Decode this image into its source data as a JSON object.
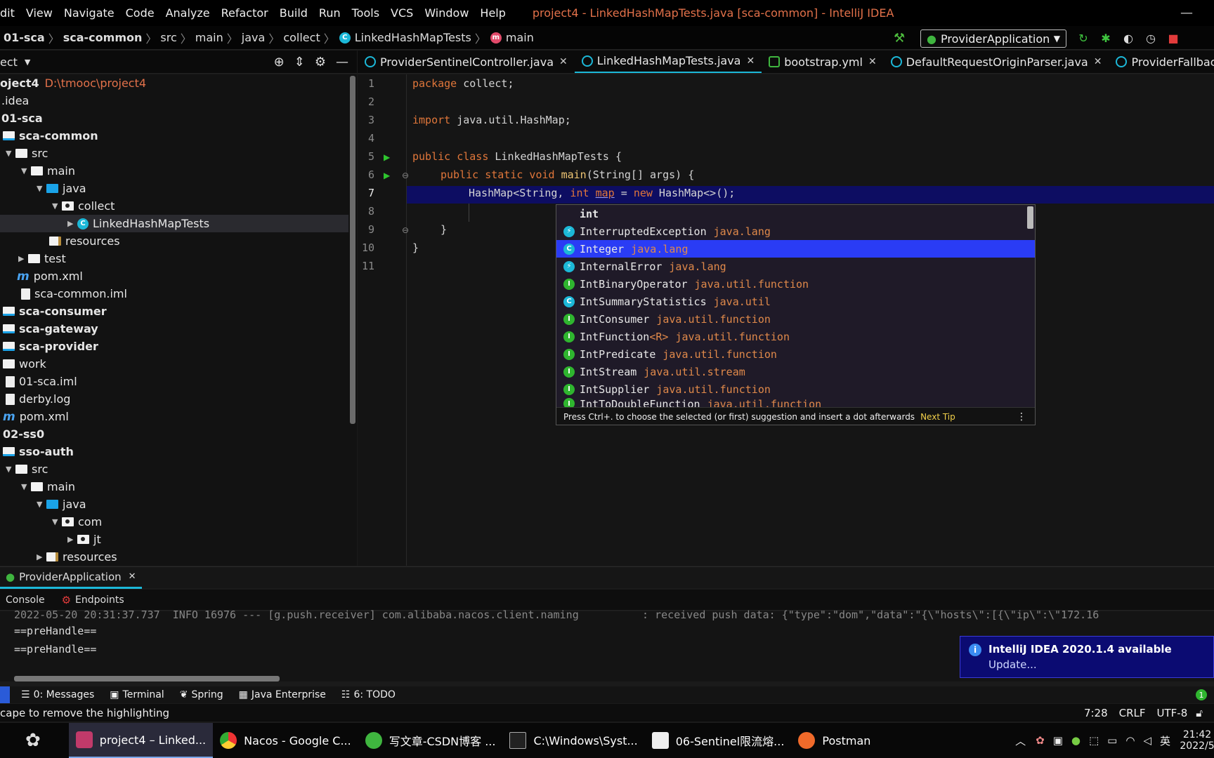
{
  "menu": {
    "items": [
      "dit",
      "View",
      "Navigate",
      "Code",
      "Analyze",
      "Refactor",
      "Build",
      "Run",
      "Tools",
      "VCS",
      "Window",
      "Help"
    ],
    "window_title": "project4 - LinkedHashMapTests.java [sca-common] - IntelliJ IDEA"
  },
  "breadcrumb": [
    "01-sca",
    "sca-common",
    "src",
    "main",
    "java",
    "collect",
    "LinkedHashMapTests",
    "main"
  ],
  "run_config": "ProviderApplication",
  "project_panel": {
    "title": "ect",
    "root_name": "oject4",
    "root_path": "D:\\tmooc\\project4",
    "items": [
      {
        "label": ".idea"
      },
      {
        "label": "01-sca"
      },
      {
        "label": "sca-common"
      },
      {
        "label": "src"
      },
      {
        "label": "main"
      },
      {
        "label": "java"
      },
      {
        "label": "collect"
      },
      {
        "label": "LinkedHashMapTests"
      },
      {
        "label": "resources"
      },
      {
        "label": "test"
      },
      {
        "label": "pom.xml"
      },
      {
        "label": "sca-common.iml"
      },
      {
        "label": "sca-consumer"
      },
      {
        "label": "sca-gateway"
      },
      {
        "label": "sca-provider"
      },
      {
        "label": "work"
      },
      {
        "label": "01-sca.iml"
      },
      {
        "label": "derby.log"
      },
      {
        "label": "pom.xml"
      },
      {
        "label": "02-ss0"
      },
      {
        "label": "sso-auth"
      },
      {
        "label": "src"
      },
      {
        "label": "main"
      },
      {
        "label": "java"
      },
      {
        "label": "com"
      },
      {
        "label": "jt"
      },
      {
        "label": "resources"
      }
    ]
  },
  "editor_tabs": [
    "ProviderSentinelController.java",
    "LinkedHashMapTests.java",
    "bootstrap.yml",
    "DefaultRequestOriginParser.java",
    "ProviderFallbackFactory.j"
  ],
  "code": {
    "line_numbers": [
      "1",
      "2",
      "3",
      "4",
      "5",
      "6",
      "7",
      "8",
      "9",
      "10",
      "11"
    ],
    "l1_kw": "package",
    "l1_rest": " collect;",
    "l3_kw": "import",
    "l3_rest": " java.util.HashMap;",
    "l5_kw": "public class",
    "l5_rest": " LinkedHashMapTests {",
    "l6_kw": "public static void",
    "l6_fn": " main",
    "l6_rest": "(String[] args) {",
    "l7_a": "HashMap<String, ",
    "l7_kw": "int",
    "l7_sp": " ",
    "l7_var": "map",
    "l7_b": " = ",
    "l7_new": "new",
    "l7_c": " HashMap<>();",
    "l9": "}",
    "l10": "}"
  },
  "completion": {
    "items": [
      {
        "name": "int",
        "generic": "",
        "pkg": "",
        "icon": "none"
      },
      {
        "name": "InterruptedException",
        "generic": "",
        "pkg": "java.lang",
        "icon": "exception"
      },
      {
        "name": "Integer",
        "generic": "",
        "pkg": "java.lang",
        "icon": "class"
      },
      {
        "name": "InternalError",
        "generic": "",
        "pkg": "java.lang",
        "icon": "exception"
      },
      {
        "name": "IntBinaryOperator",
        "generic": "",
        "pkg": "java.util.function",
        "icon": "interface"
      },
      {
        "name": "IntSummaryStatistics",
        "generic": "",
        "pkg": "java.util",
        "icon": "class"
      },
      {
        "name": "IntConsumer",
        "generic": "",
        "pkg": "java.util.function",
        "icon": "interface"
      },
      {
        "name": "IntFunction",
        "generic": "<R>",
        "pkg": "java.util.function",
        "icon": "interface"
      },
      {
        "name": "IntPredicate",
        "generic": "",
        "pkg": "java.util.function",
        "icon": "interface"
      },
      {
        "name": "IntStream",
        "generic": "",
        "pkg": "java.util.stream",
        "icon": "interface"
      },
      {
        "name": "IntSupplier",
        "generic": "",
        "pkg": "java.util.function",
        "icon": "interface"
      },
      {
        "name": "IntToDoubleFunction",
        "generic": "",
        "pkg": "java.util.function",
        "icon": "interface"
      }
    ],
    "selected_index": 2,
    "footer_text": "Press Ctrl+. to choose the selected (or first) suggestion and insert a dot afterwards",
    "next_tip": "Next Tip"
  },
  "run_tab": "ProviderApplication",
  "console_tabs": [
    "Console",
    "Endpoints"
  ],
  "console_lines": [
    "2022-05-20 20:31:37.737  INFO 16976 --- [g.push.receiver] com.alibaba.nacos.client.naming          : received push data: {\"type\":\"dom\",\"data\":\"{\\\"hosts\\\":[{\\\"ip\\\":\\\"172.16",
    "==preHandle==",
    "==preHandle=="
  ],
  "notification": {
    "title": "IntelliJ IDEA 2020.1.4 available",
    "link": "Update..."
  },
  "tool_windows": [
    "0: Messages",
    "Terminal",
    "Spring",
    "Java Enterprise",
    "6: TODO"
  ],
  "status": {
    "message": "cape to remove the highlighting",
    "position": "7:28",
    "line_sep": "CRLF",
    "encoding": "UTF-8"
  },
  "taskbar": {
    "items": [
      "project4 – Linked...",
      "Nacos - Google C...",
      "写文章-CSDN博客 ...",
      "C:\\Windows\\Syst...",
      "06-Sentinel限流熔...",
      "Postman"
    ],
    "time": "21:42",
    "date": "2022/5",
    "ime": "英"
  },
  "colors": {
    "keyword": "#e0763a",
    "selection": "#2a3cf5",
    "current_line": "#0d0d62",
    "accent": "#1cb8d8"
  }
}
